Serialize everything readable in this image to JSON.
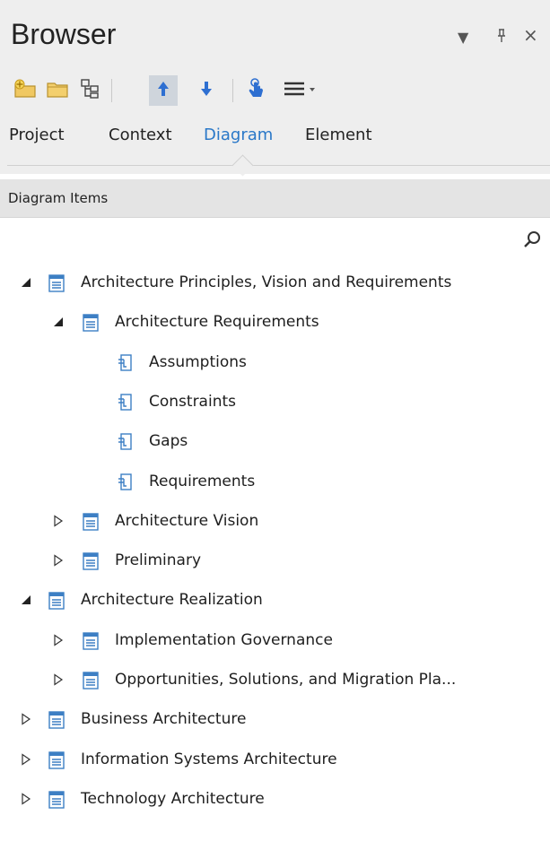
{
  "panel": {
    "title": "Browser",
    "controls": {
      "menu": "▼",
      "pin": "⊥",
      "close": "×"
    }
  },
  "toolbar": {
    "icons": [
      "new-root-folder-icon",
      "folder-icon",
      "diagram-tree-icon",
      "move-up-icon",
      "move-down-icon",
      "touch-icon",
      "menu-icon"
    ]
  },
  "tabs": [
    {
      "label": "Project",
      "active": false
    },
    {
      "label": "Context",
      "active": false
    },
    {
      "label": "Diagram",
      "active": true
    },
    {
      "label": "Element",
      "active": false
    }
  ],
  "section": {
    "label": "Diagram Items"
  },
  "tree": [
    {
      "label": "Architecture Principles, Vision and Requirements",
      "level": 0,
      "state": "expanded",
      "icon": "package-icon"
    },
    {
      "label": "Architecture Requirements",
      "level": 1,
      "state": "expanded",
      "icon": "package-icon"
    },
    {
      "label": "Assumptions",
      "level": 2,
      "state": "leaf",
      "icon": "requirement-icon"
    },
    {
      "label": "Constraints",
      "level": 2,
      "state": "leaf",
      "icon": "requirement-icon"
    },
    {
      "label": "Gaps",
      "level": 2,
      "state": "leaf",
      "icon": "requirement-icon"
    },
    {
      "label": "Requirements",
      "level": 2,
      "state": "leaf",
      "icon": "requirement-icon"
    },
    {
      "label": "Architecture Vision",
      "level": 1,
      "state": "collapsed",
      "icon": "package-icon"
    },
    {
      "label": "Preliminary",
      "level": 1,
      "state": "collapsed",
      "icon": "package-icon"
    },
    {
      "label": "Architecture Realization",
      "level": 0,
      "state": "expanded",
      "icon": "package-icon"
    },
    {
      "label": "Implementation Governance",
      "level": 1,
      "state": "collapsed",
      "icon": "package-icon"
    },
    {
      "label": "Opportunities, Solutions, and Migration Pla...",
      "level": 1,
      "state": "collapsed",
      "icon": "package-icon"
    },
    {
      "label": "Business Architecture",
      "level": 0,
      "state": "collapsed",
      "icon": "package-icon"
    },
    {
      "label": "Information Systems Architecture",
      "level": 0,
      "state": "collapsed",
      "icon": "package-icon"
    },
    {
      "label": "Technology Architecture",
      "level": 0,
      "state": "collapsed",
      "icon": "package-icon"
    }
  ],
  "colors": {
    "accent": "#2a78c8",
    "package": "#3d7fc4",
    "folder": "#e6b94a",
    "toolbar_blue": "#2e6fd1"
  }
}
